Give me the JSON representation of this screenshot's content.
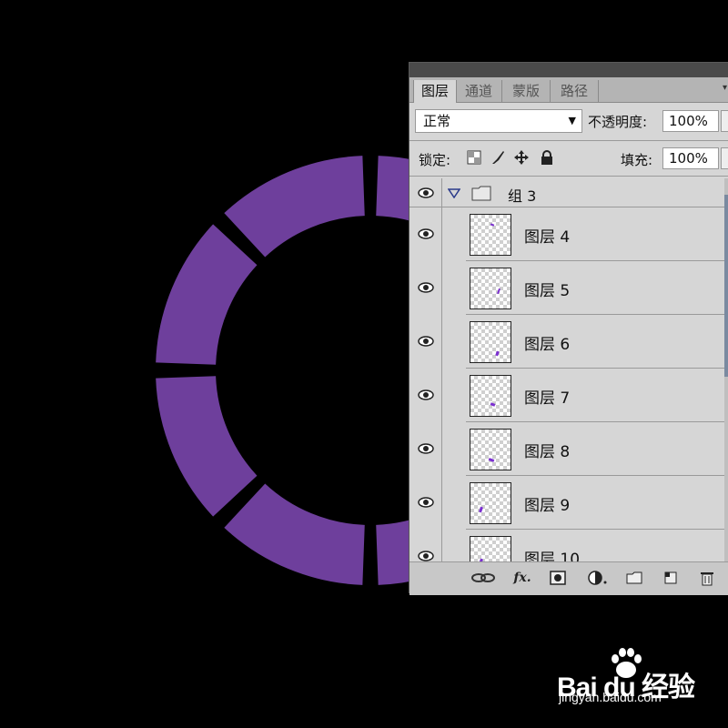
{
  "colors": {
    "ring": "#6e3f9c",
    "panel": "#d6d6d6",
    "thumb_mark": "#7b2fd0"
  },
  "canvas": {
    "ring_segments": 8
  },
  "panel": {
    "tabs": [
      {
        "label": "图层",
        "active": true
      },
      {
        "label": "通道",
        "active": false
      },
      {
        "label": "蒙版",
        "active": false
      },
      {
        "label": "路径",
        "active": false
      }
    ],
    "blend_mode": "正常",
    "opacity_label": "不透明度:",
    "opacity_value": "100%",
    "lock_label": "锁定:",
    "fill_label": "填充:",
    "fill_value": "100%",
    "group": {
      "name": "组 3",
      "expanded": true
    },
    "layers": [
      {
        "name": "图层 4"
      },
      {
        "name": "图层 5"
      },
      {
        "name": "图层 6"
      },
      {
        "name": "图层 7"
      },
      {
        "name": "图层 8"
      },
      {
        "name": "图层 9"
      },
      {
        "name": "图层 10"
      }
    ],
    "bottom_icons": [
      "link-icon",
      "fx-icon",
      "mask-icon",
      "adjustment-icon",
      "folder-icon",
      "new-layer-icon",
      "trash-icon"
    ]
  },
  "watermark": {
    "logo": "Bai du 经验",
    "url": "jingyan.baidu.com"
  }
}
